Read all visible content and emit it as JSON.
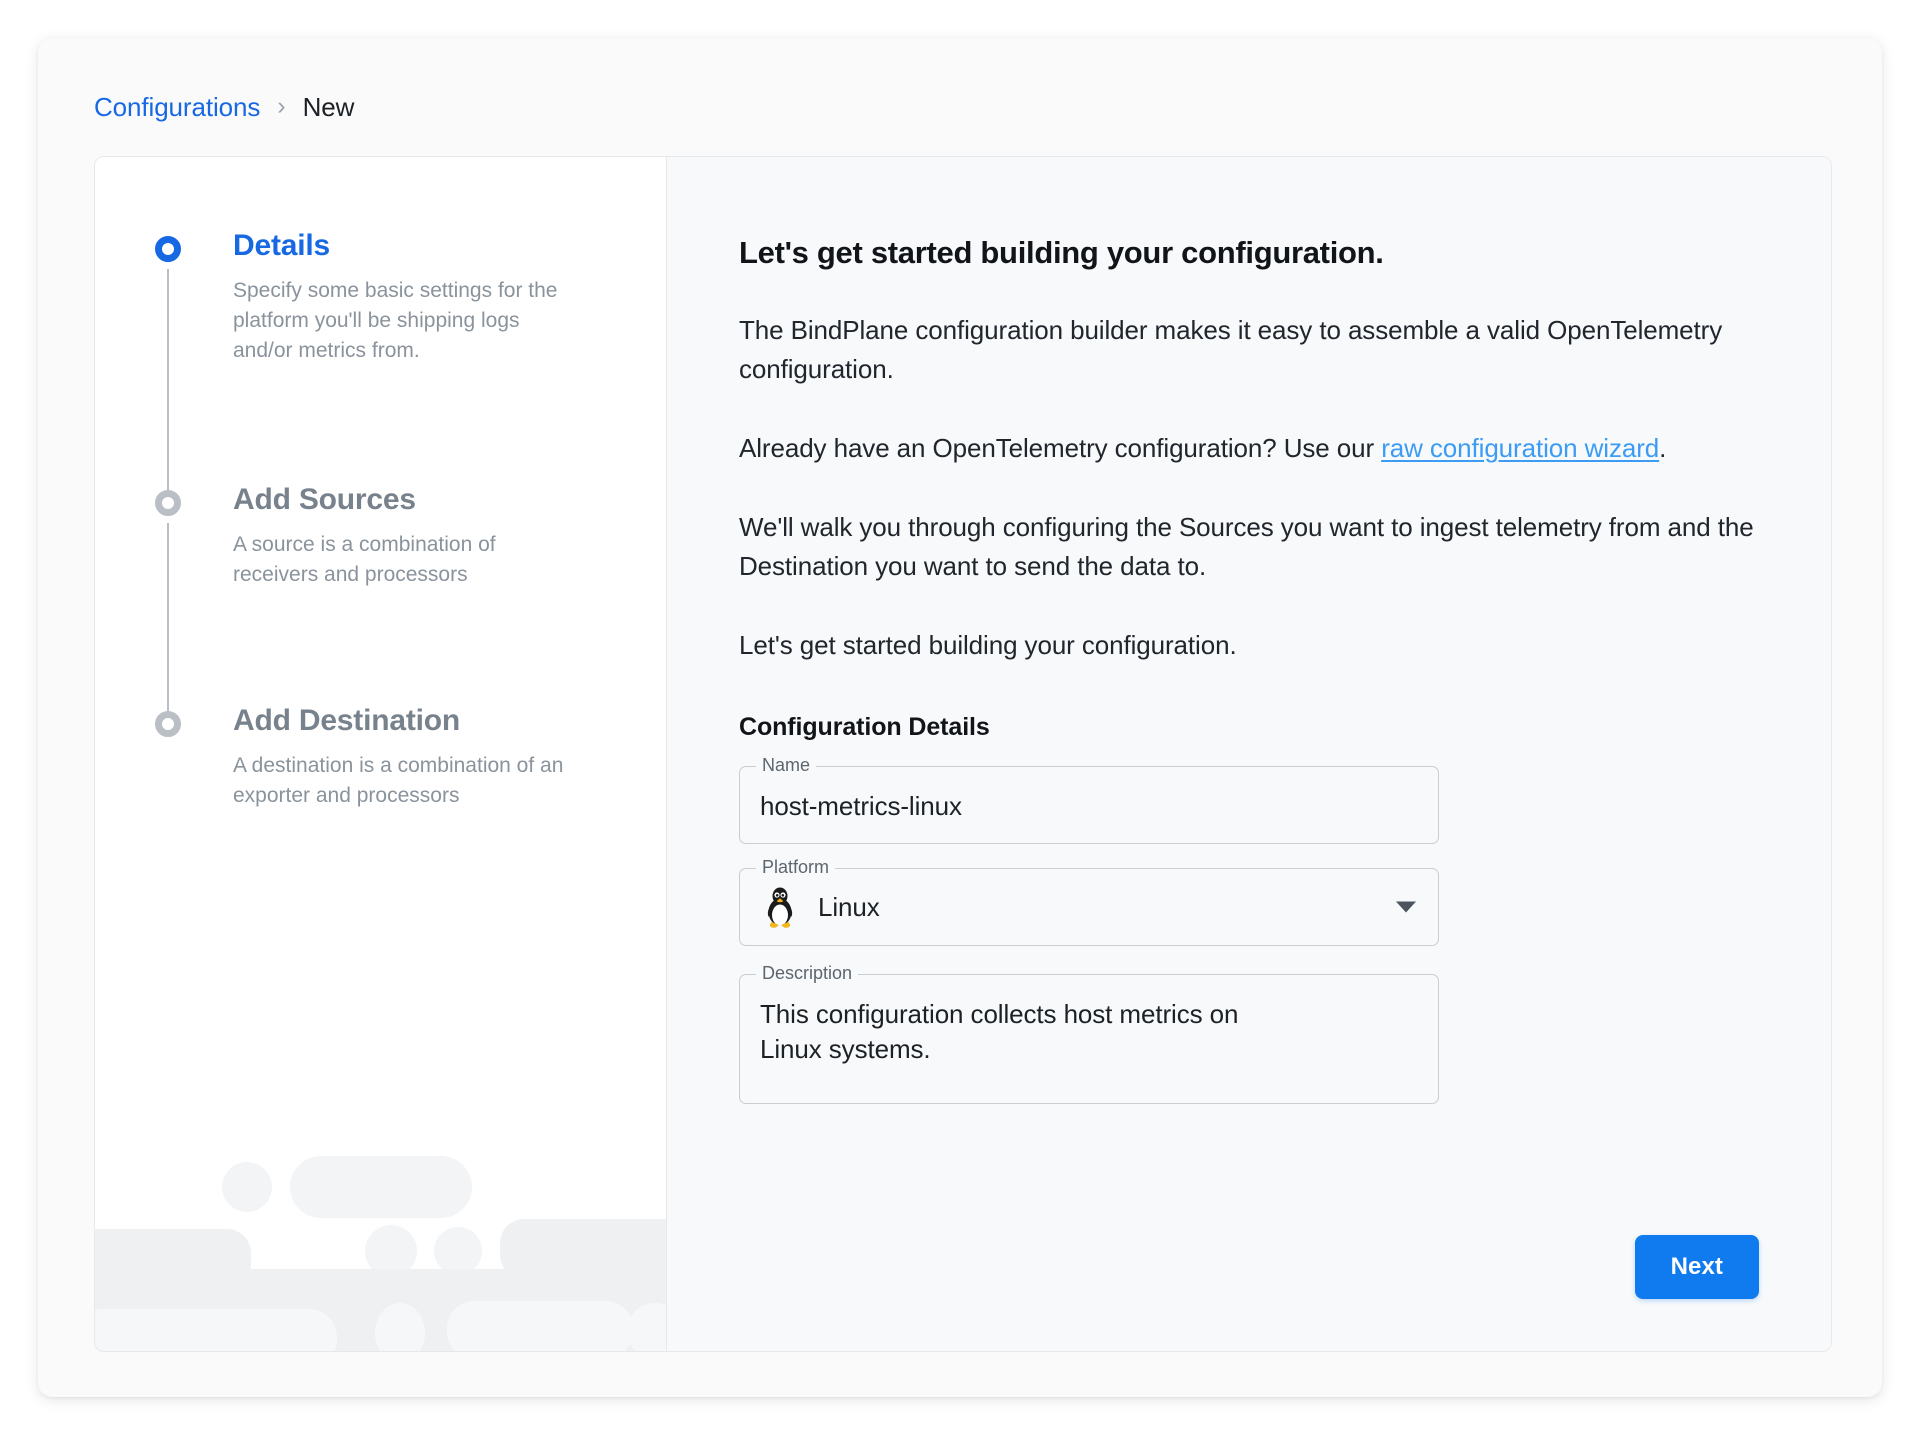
{
  "breadcrumb": {
    "root": "Configurations",
    "separator": "›",
    "current": "New"
  },
  "stepper": {
    "steps": [
      {
        "title": "Details",
        "description": "Specify some basic settings for the platform you'll be shipping logs and/or metrics from.",
        "state": "active",
        "marker_color": "#1668e3"
      },
      {
        "title": "Add Sources",
        "description": "A source is a combination of receivers and processors",
        "state": "inactive",
        "marker_color": "#b9bfc5"
      },
      {
        "title": "Add Destination",
        "description": "A destination is a combination of an exporter and processors",
        "state": "inactive",
        "marker_color": "#b9bfc5"
      }
    ]
  },
  "content": {
    "headline": "Let's get started building your configuration.",
    "paragraph_1": "The BindPlane configuration builder makes it easy to assemble a valid OpenTelemetry configuration.",
    "paragraph_2_prefix": "Already have an OpenTelemetry configuration? Use our ",
    "paragraph_2_link": "raw configuration wizard",
    "paragraph_2_suffix": ".",
    "paragraph_3": "We'll walk you through configuring the Sources you want to ingest telemetry from and the Destination you want to send the data to.",
    "paragraph_4": "Let's get started building your configuration.",
    "section_title": "Configuration Details"
  },
  "form": {
    "name": {
      "label": "Name",
      "value": "host-metrics-linux"
    },
    "platform": {
      "label": "Platform",
      "value": "Linux",
      "icon": "linux-penguin-icon"
    },
    "description": {
      "label": "Description",
      "value": "This configuration collects host metrics on Linux systems."
    }
  },
  "footer": {
    "next_label": "Next"
  },
  "colors": {
    "accent": "#1668e3",
    "button": "#0f7bef",
    "link": "#3b9bf5",
    "muted": "#8a939c"
  }
}
